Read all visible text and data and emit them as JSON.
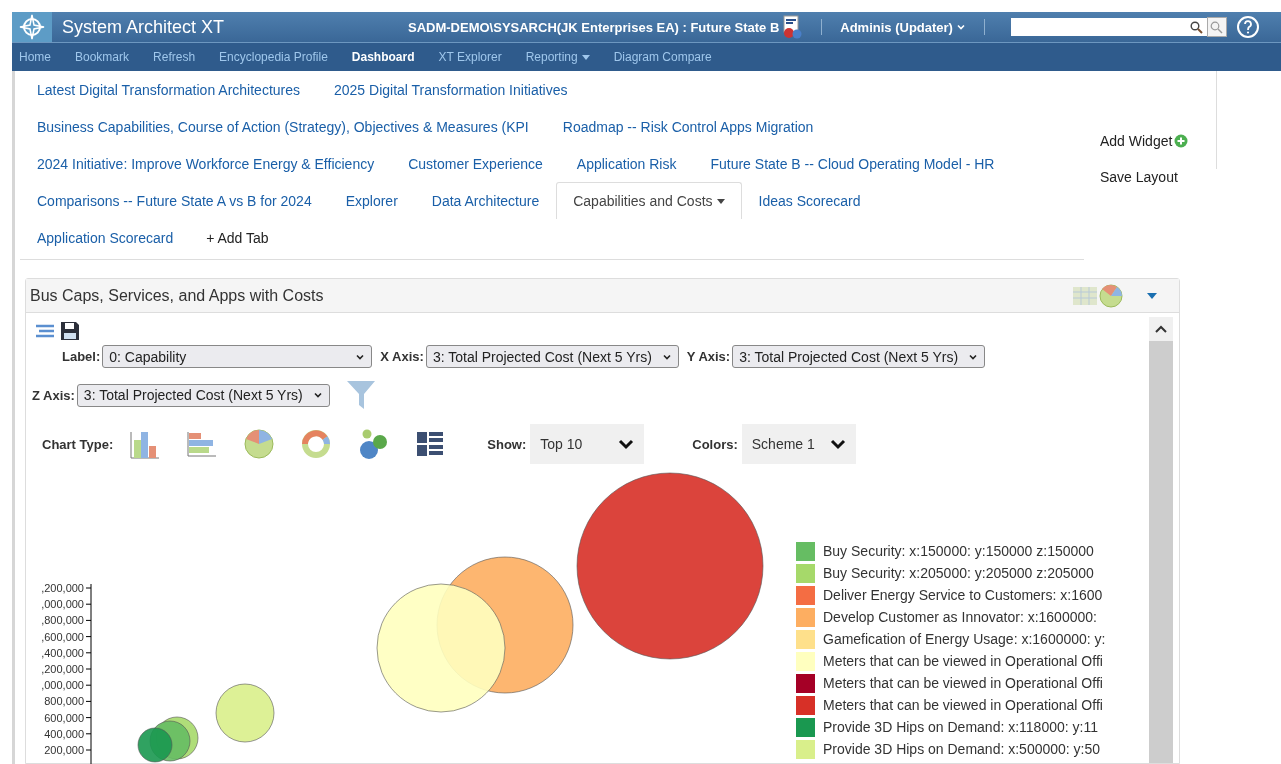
{
  "header": {
    "app_title": "System Architect XT",
    "context": "SADM-DEMO\\SYSARCH(JK Enterprises EA) : Future State B",
    "user": "Adminis (Updater)"
  },
  "nav": [
    {
      "label": "Home",
      "selected": false,
      "dropdown": false
    },
    {
      "label": "Bookmark",
      "selected": false,
      "dropdown": false
    },
    {
      "label": "Refresh",
      "selected": false,
      "dropdown": false
    },
    {
      "label": "Encyclopedia Profile",
      "selected": false,
      "dropdown": false
    },
    {
      "label": "Dashboard",
      "selected": true,
      "dropdown": false
    },
    {
      "label": "XT Explorer",
      "selected": false,
      "dropdown": false
    },
    {
      "label": "Reporting",
      "selected": false,
      "dropdown": true
    },
    {
      "label": "Diagram Compare",
      "selected": false,
      "dropdown": false
    }
  ],
  "dashboard_tabs": [
    [
      {
        "label": "Latest Digital Transformation Architectures",
        "selected": false,
        "dropdown": false
      },
      {
        "label": "2025 Digital Transformation Initiatives",
        "selected": false,
        "dropdown": false
      }
    ],
    [
      {
        "label": "Business Capabilities, Course of Action (Strategy), Objectives & Measures (KPI",
        "selected": false,
        "dropdown": false
      },
      {
        "label": "Roadmap -- Risk Control Apps Migration",
        "selected": false,
        "dropdown": false
      }
    ],
    [
      {
        "label": "2024 Initiative: Improve Workforce Energy & Efficiency",
        "selected": false,
        "dropdown": false
      },
      {
        "label": "Customer Experience",
        "selected": false,
        "dropdown": false
      },
      {
        "label": "Application Risk",
        "selected": false,
        "dropdown": false
      },
      {
        "label": "Future State B -- Cloud Operating Model - HR",
        "selected": false,
        "dropdown": false
      }
    ],
    [
      {
        "label": "Comparisons -- Future State A vs B for 2024",
        "selected": false,
        "dropdown": false
      },
      {
        "label": "Explorer",
        "selected": false,
        "dropdown": false
      },
      {
        "label": "Data Architecture",
        "selected": false,
        "dropdown": false
      },
      {
        "label": "Capabilities and Costs",
        "selected": true,
        "dropdown": true
      },
      {
        "label": "Ideas Scorecard",
        "selected": false,
        "dropdown": false
      }
    ],
    [
      {
        "label": "Application Scorecard",
        "selected": false,
        "dropdown": false
      }
    ]
  ],
  "add_tab": "+ Add Tab",
  "actions": {
    "add_widget": "Add Widget",
    "save_layout": "Save Layout"
  },
  "widget": {
    "title": "Bus Caps, Services, and Apps with Costs",
    "axes": [
      {
        "label": "Label:",
        "value": "0: Capability",
        "kind": "wide"
      },
      {
        "label": "X Axis:",
        "value": "3: Total Projected Cost (Next 5 Yrs)",
        "kind": "normal"
      },
      {
        "label": "Y Axis:",
        "value": "3: Total Projected Cost (Next 5 Yrs)",
        "kind": "normal"
      },
      {
        "label": "Z Axis:",
        "value": "3: Total Projected Cost (Next 5 Yrs)",
        "kind": "normal"
      }
    ],
    "chart_type_label": "Chart Type:",
    "chart_types": [
      {
        "kind": "bar",
        "selected": false
      },
      {
        "kind": "hbar",
        "selected": false
      },
      {
        "kind": "pie",
        "selected": false
      },
      {
        "kind": "donut",
        "selected": false
      },
      {
        "kind": "bubble",
        "selected": false
      },
      {
        "kind": "table",
        "selected": false
      }
    ],
    "show": {
      "label": "Show:",
      "value": "Top 10"
    },
    "colors": {
      "label": "Colors:",
      "value": "Scheme 1"
    },
    "y_axis_labels": [
      ",200,000",
      ",000,000",
      ",800,000",
      ",600,000",
      ",400,000",
      ",200,000",
      ",000,000",
      "800,000",
      "600,000",
      "400,000",
      "200,000"
    ],
    "legend": [
      {
        "label": "Buy Security: x:150000: y:150000 z:150000",
        "color": "#66bd63"
      },
      {
        "label": "Buy Security: x:205000: y:205000 z:205000",
        "color": "#a6d96a"
      },
      {
        "label": "Deliver Energy Service to Customers: x:1600",
        "color": "#f46d43"
      },
      {
        "label": "Develop Customer as Innovator: x:1600000:",
        "color": "#fdae61"
      },
      {
        "label": "Gamefication of Energy Usage: x:1600000: y:",
        "color": "#fee08b"
      },
      {
        "label": "Meters that can be viewed in Operational Offi",
        "color": "#ffffbf"
      },
      {
        "label": "Meters that can be viewed in Operational Offi",
        "color": "#a50026"
      },
      {
        "label": "Meters that can be viewed in Operational Offi",
        "color": "#d73027"
      },
      {
        "label": "Provide 3D Hips on Demand: x:118000: y:11",
        "color": "#1a9850"
      },
      {
        "label": "Provide 3D Hips on Demand: x:500000: y:50",
        "color": "#d9ef8b"
      }
    ]
  }
}
